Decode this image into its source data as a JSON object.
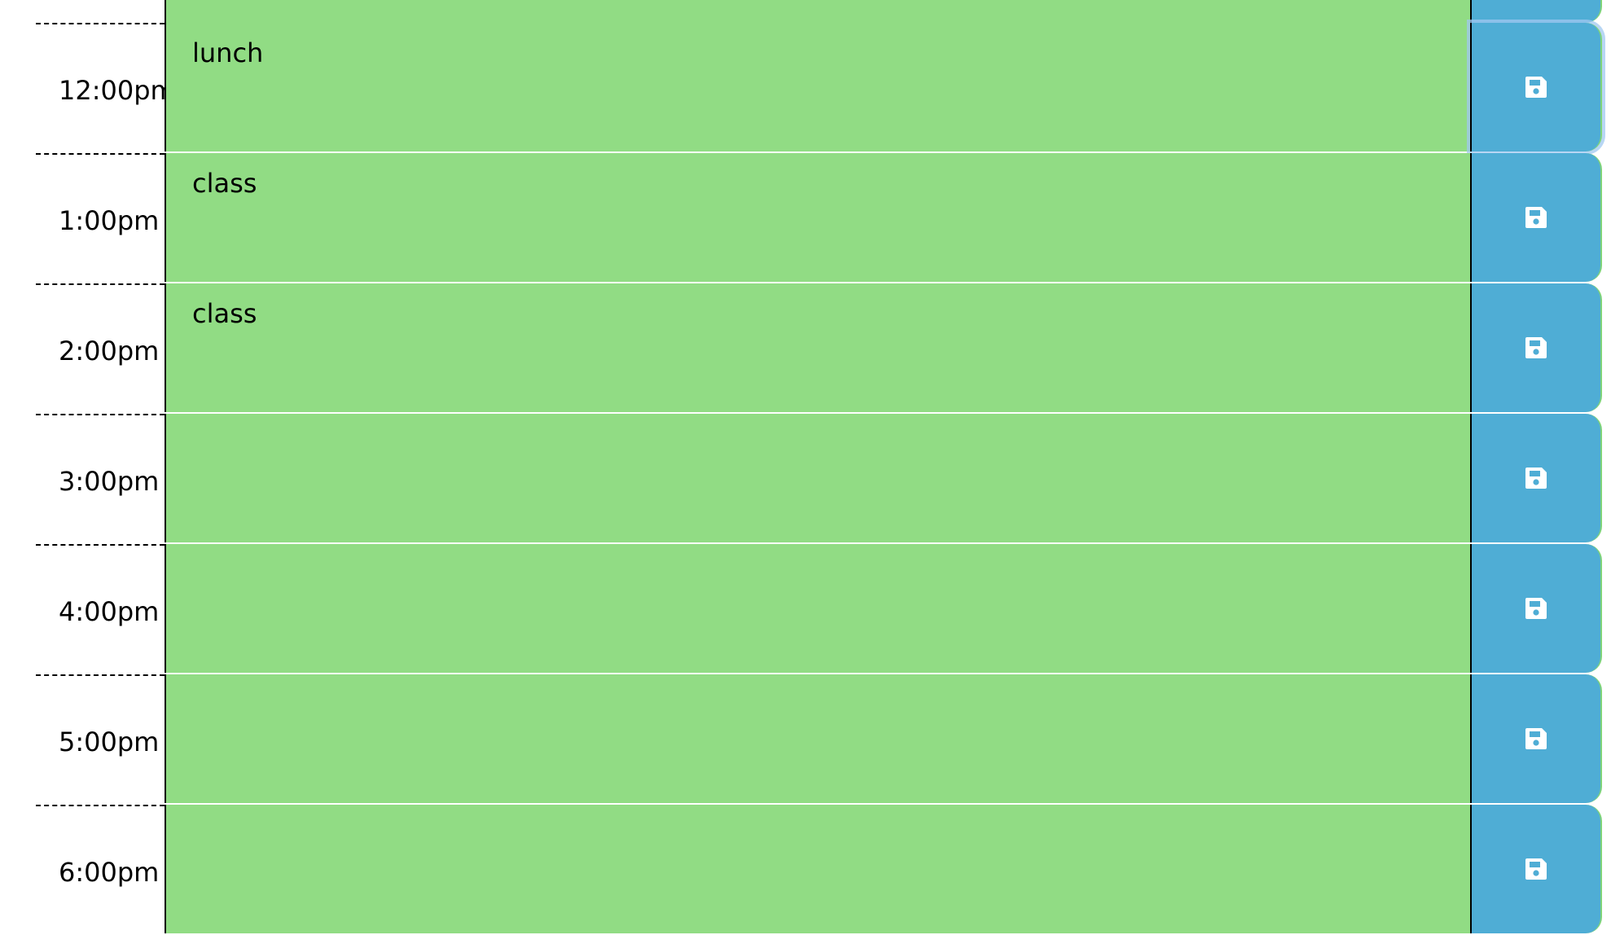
{
  "colors": {
    "present_row": "#91dc84",
    "save_button": "#4fadd5"
  },
  "rows": [
    {
      "hour": "12:00pm",
      "description": "lunch",
      "save_icon": "floppy-disk-icon"
    },
    {
      "hour": "1:00pm",
      "description": "class",
      "save_icon": "floppy-disk-icon"
    },
    {
      "hour": "2:00pm",
      "description": "class",
      "save_icon": "floppy-disk-icon"
    },
    {
      "hour": "3:00pm",
      "description": "",
      "save_icon": "floppy-disk-icon"
    },
    {
      "hour": "4:00pm",
      "description": "",
      "save_icon": "floppy-disk-icon"
    },
    {
      "hour": "5:00pm",
      "description": "",
      "save_icon": "floppy-disk-icon"
    },
    {
      "hour": "6:00pm",
      "description": "",
      "save_icon": "floppy-disk-icon"
    }
  ]
}
